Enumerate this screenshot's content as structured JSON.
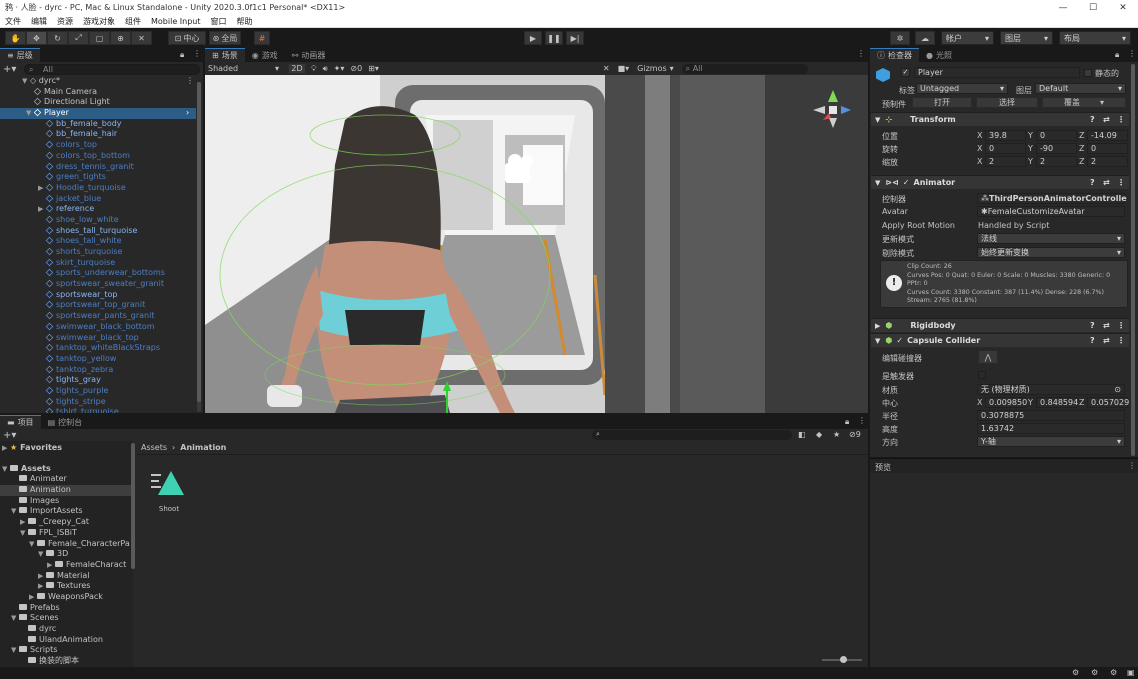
{
  "window": {
    "app_title": "鸦 · 人脸 - dyrc - PC, Mac & Linux Standalone - Unity 2020.3.0f1c1 Personal* <DX11>",
    "min": "—",
    "max": "☐",
    "close": "✕"
  },
  "menu": [
    "文件",
    "编辑",
    "资源",
    "游戏对象",
    "组件",
    "Mobile Input",
    "窗口",
    "帮助"
  ],
  "toolbar": {
    "pivot": "中心",
    "global": "全局",
    "account": "帐户",
    "layers": "图层",
    "layout": "布局"
  },
  "hierarchy": {
    "tab": "层级",
    "search_placeholder": "All",
    "scene": "dyrc*",
    "items": [
      {
        "label": "Main Camera",
        "indent": 1,
        "style": "w",
        "arrow": ""
      },
      {
        "label": "Directional Light",
        "indent": 1,
        "style": "w",
        "arrow": ""
      },
      {
        "label": "Player",
        "indent": 1,
        "style": "sel",
        "arrow": "▼"
      },
      {
        "label": "bb_female_body",
        "indent": 2,
        "style": "b2",
        "arrow": ""
      },
      {
        "label": "bb_female_hair",
        "indent": 2,
        "style": "b2",
        "arrow": ""
      },
      {
        "label": "colors_top",
        "indent": 2,
        "style": "b",
        "arrow": ""
      },
      {
        "label": "colors_top_bottom",
        "indent": 2,
        "style": "b",
        "arrow": ""
      },
      {
        "label": "dress_tennis_granit",
        "indent": 2,
        "style": "b",
        "arrow": ""
      },
      {
        "label": "green_tights",
        "indent": 2,
        "style": "b",
        "arrow": ""
      },
      {
        "label": "Hoodie_turquoise",
        "indent": 2,
        "style": "b",
        "arrow": "▶"
      },
      {
        "label": "jacket_blue",
        "indent": 2,
        "style": "b",
        "arrow": ""
      },
      {
        "label": "reference",
        "indent": 2,
        "style": "b2",
        "arrow": "▶"
      },
      {
        "label": "shoe_low_white",
        "indent": 2,
        "style": "b",
        "arrow": ""
      },
      {
        "label": "shoes_tall_turquoise",
        "indent": 2,
        "style": "b2",
        "arrow": ""
      },
      {
        "label": "shoes_tall_white",
        "indent": 2,
        "style": "b",
        "arrow": ""
      },
      {
        "label": "shorts_turquoise",
        "indent": 2,
        "style": "b",
        "arrow": ""
      },
      {
        "label": "skirt_turquoise",
        "indent": 2,
        "style": "b",
        "arrow": ""
      },
      {
        "label": "sports_underwear_bottoms",
        "indent": 2,
        "style": "b",
        "arrow": ""
      },
      {
        "label": "sportswear_sweater_granit",
        "indent": 2,
        "style": "b",
        "arrow": ""
      },
      {
        "label": "sportswear_top",
        "indent": 2,
        "style": "b2",
        "arrow": ""
      },
      {
        "label": "sportswear_top_granit",
        "indent": 2,
        "style": "b",
        "arrow": ""
      },
      {
        "label": "sportswear_pants_granit",
        "indent": 2,
        "style": "b",
        "arrow": ""
      },
      {
        "label": "swimwear_black_bottom",
        "indent": 2,
        "style": "b",
        "arrow": ""
      },
      {
        "label": "swimwear_black_top",
        "indent": 2,
        "style": "b",
        "arrow": ""
      },
      {
        "label": "tanktop_whiteBlackStraps",
        "indent": 2,
        "style": "b",
        "arrow": ""
      },
      {
        "label": "tanktop_yellow",
        "indent": 2,
        "style": "b",
        "arrow": ""
      },
      {
        "label": "tanktop_zebra",
        "indent": 2,
        "style": "b",
        "arrow": ""
      },
      {
        "label": "tights_gray",
        "indent": 2,
        "style": "b2",
        "arrow": ""
      },
      {
        "label": "tights_purple",
        "indent": 2,
        "style": "b",
        "arrow": ""
      },
      {
        "label": "tights_stripe",
        "indent": 2,
        "style": "b",
        "arrow": ""
      },
      {
        "label": "tshirt_turquoise",
        "indent": 2,
        "style": "b",
        "arrow": ""
      }
    ]
  },
  "scene_view": {
    "tab_scene": "场景",
    "tab_game": "游戏",
    "tab_animator": "动画器",
    "shading": "Shaded",
    "mode2d": "2D",
    "hidden_count": "0",
    "gizmos": "Gizmos",
    "search_placeholder": "All"
  },
  "inspector": {
    "tab": "检查器",
    "tab2": "光照",
    "object_name": "Player",
    "static": "静态的",
    "tag_label": "标签",
    "tag_value": "Untagged",
    "layer_label": "图层",
    "layer_value": "Default",
    "prefab_label": "预制件",
    "prefab_open": "打开",
    "prefab_select": "选择",
    "prefab_overrides": "覆盖",
    "transform": {
      "title": "Transform",
      "pos_label": "位置",
      "rot_label": "旋转",
      "scale_label": "缩放",
      "position": [
        "39.8",
        "0",
        "-14.09"
      ],
      "rotation": [
        "0",
        "-90",
        "0"
      ],
      "scale": [
        "2",
        "2",
        "2"
      ]
    },
    "animator": {
      "title": "Animator",
      "controller_label": "控制器",
      "controller": "ThirdPersonAnimatorControlle",
      "avatar_label": "Avatar",
      "avatar": "FemaleCustomizeAvatar",
      "root_motion_label": "Apply Root Motion",
      "root_motion": "Handled by Script",
      "update_label": "更新模式",
      "update": "法线",
      "culling_label": "剔除模式",
      "culling": "始终更新变换",
      "info": [
        "Clip Count: 26",
        "Curves Pos: 0 Quat: 0 Euler: 0 Scale: 0 Muscles: 3380 Generic: 0",
        "PPtr: 0",
        "Curves Count: 3380 Constant: 387 (11.4%) Dense: 228 (6.7%)",
        "Stream: 2765 (81.8%)"
      ]
    },
    "rigidbody": {
      "title": "Rigidbody"
    },
    "capsule": {
      "title": "Capsule Collider",
      "edit_label": "编辑碰撞器",
      "trigger_label": "是触发器",
      "material_label": "材质",
      "material": "无 (物理材质)",
      "center_label": "中心",
      "center": [
        "0.009850",
        "0.848594",
        "0.057029"
      ],
      "radius_label": "半径",
      "radius": "0.3078875",
      "height_label": "高度",
      "height": "1.63742",
      "direction_label": "方向",
      "direction": "Y-轴"
    },
    "preview": "预览"
  },
  "project": {
    "tab": "项目",
    "tab2": "控制台",
    "favorites": "Favorites",
    "tree": [
      {
        "label": "Assets",
        "indent": 0,
        "arrow": "▼",
        "bold": true
      },
      {
        "label": "Animater",
        "indent": 1,
        "arrow": ""
      },
      {
        "label": "Animation",
        "indent": 1,
        "arrow": "",
        "sel": true
      },
      {
        "label": "Images",
        "indent": 1,
        "arrow": ""
      },
      {
        "label": "ImportAssets",
        "indent": 1,
        "arrow": "▼"
      },
      {
        "label": "_Creepy_Cat",
        "indent": 2,
        "arrow": "▶"
      },
      {
        "label": "FPL_ISBiT",
        "indent": 2,
        "arrow": "▼"
      },
      {
        "label": "Female_CharacterPa",
        "indent": 3,
        "arrow": "▼"
      },
      {
        "label": "3D",
        "indent": 4,
        "arrow": "▼"
      },
      {
        "label": "FemaleCharact",
        "indent": 5,
        "arrow": "▶"
      },
      {
        "label": "Material",
        "indent": 4,
        "arrow": "▶"
      },
      {
        "label": "Textures",
        "indent": 4,
        "arrow": "▶"
      },
      {
        "label": "WeaponsPack",
        "indent": 3,
        "arrow": "▶"
      },
      {
        "label": "Prefabs",
        "indent": 1,
        "arrow": ""
      },
      {
        "label": "Scenes",
        "indent": 1,
        "arrow": "▼"
      },
      {
        "label": "dyrc",
        "indent": 2,
        "arrow": ""
      },
      {
        "label": "UlandAnimation",
        "indent": 2,
        "arrow": ""
      },
      {
        "label": "Scripts",
        "indent": 1,
        "arrow": "▼"
      },
      {
        "label": "换装的脚本",
        "indent": 2,
        "arrow": ""
      }
    ],
    "breadcrumb_root": "Assets",
    "breadcrumb_sep": "›",
    "breadcrumb_current": "Animation",
    "asset_name": "Shoot",
    "count": "9"
  }
}
